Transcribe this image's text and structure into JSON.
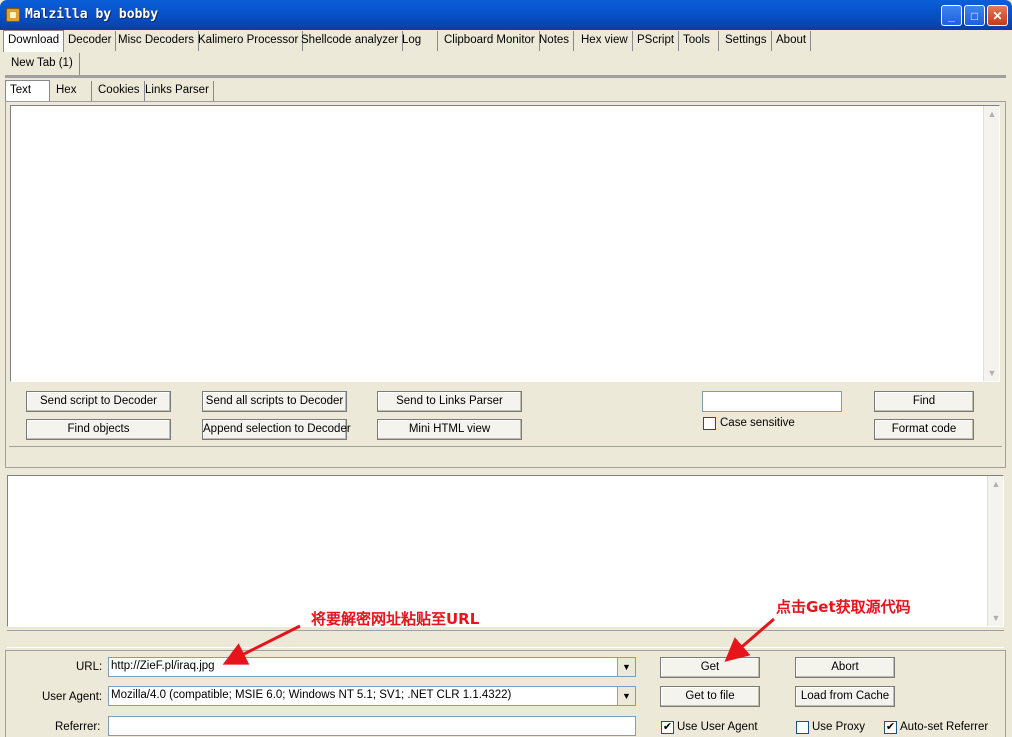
{
  "window": {
    "title": "Malzilla by bobby"
  },
  "main_tabs": [
    {
      "label": "Download",
      "active": true
    },
    {
      "label": "Decoder"
    },
    {
      "label": "Misc Decoders"
    },
    {
      "label": "Kalimero Processor"
    },
    {
      "label": "Shellcode analyzer"
    },
    {
      "label": "Log"
    },
    {
      "label": "Clipboard Monitor"
    },
    {
      "label": "Notes"
    },
    {
      "label": "Hex view"
    },
    {
      "label": "PScript"
    },
    {
      "label": "Tools"
    },
    {
      "label": "Settings"
    },
    {
      "label": "About"
    }
  ],
  "doc_tab": {
    "label": "New Tab (1)"
  },
  "sub_tabs": [
    {
      "label": "Text",
      "active": true
    },
    {
      "label": "Hex"
    },
    {
      "label": "Cookies"
    },
    {
      "label": "Links Parser"
    }
  ],
  "buttons": {
    "send_script": "Send script to Decoder",
    "send_all": "Send all scripts to Decoder",
    "send_links": "Send to Links Parser",
    "find_objects": "Find objects",
    "append_sel": "Append selection to Decoder",
    "mini_html": "Mini HTML view",
    "find": "Find",
    "format_code": "Format code",
    "get": "Get",
    "abort": "Abort",
    "get_to_file": "Get to file",
    "load_cache": "Load from Cache"
  },
  "find_field": {
    "value": ""
  },
  "case_sensitive": {
    "label": "Case sensitive",
    "checked": false
  },
  "form": {
    "url_label": "URL:",
    "url_value": "http://ZieF.pl/iraq.jpg",
    "ua_label": "User Agent:",
    "ua_value": "Mozilla/4.0 (compatible; MSIE 6.0; Windows NT 5.1; SV1; .NET CLR 1.1.4322)",
    "ref_label": "Referrer:",
    "ref_value": ""
  },
  "checkboxes": {
    "use_ua": {
      "label": "Use User Agent",
      "checked": true
    },
    "use_proxy": {
      "label": "Use Proxy",
      "checked": false
    },
    "auto_ref": {
      "label": "Auto-set Referrer",
      "checked": true
    }
  },
  "annotations": {
    "url_hint": "将要解密网址粘贴至URL",
    "get_hint": "点击Get获取源代码"
  },
  "colors": {
    "annotation": "#e8141b",
    "titlebar": "#0851c9"
  }
}
